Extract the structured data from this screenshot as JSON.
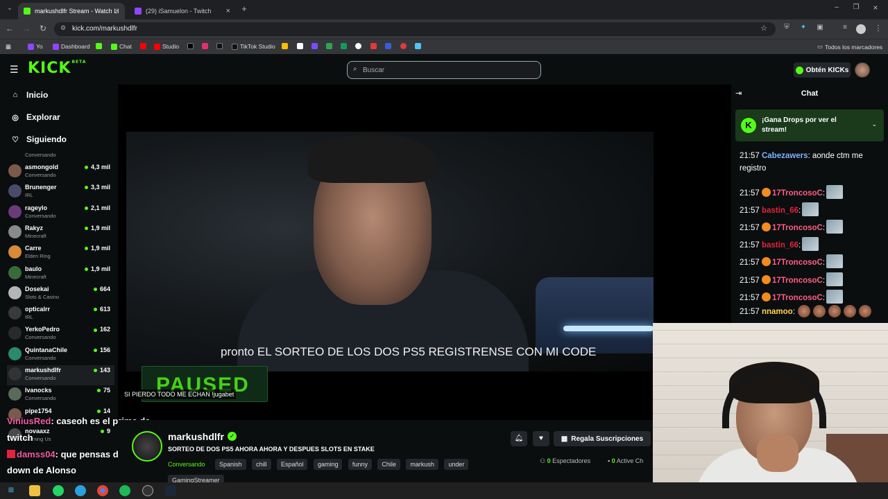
{
  "browser": {
    "tabs": [
      {
        "title": "markushdlfr Stream - Watch Li",
        "active": true,
        "color": "#53fc18"
      },
      {
        "title": "(29) iSamuelon - Twitch",
        "active": false,
        "color": "#9146ff"
      }
    ],
    "url": "kick.com/markushdlfr",
    "bookmarks": [
      "Yo",
      "Dashboard",
      "Chat",
      "Studio",
      "TikTok Studio"
    ],
    "bookmarks_folder": "Todos los marcadores"
  },
  "header": {
    "logo": "KICK",
    "logo_badge": "BETA",
    "search_placeholder": "Buscar",
    "get_kicks": "Obtén KICKs"
  },
  "sidebar": {
    "nav": [
      {
        "label": "Inicio",
        "icon": "home-icon"
      },
      {
        "label": "Explorar",
        "icon": "compass-icon"
      },
      {
        "label": "Siguiendo",
        "icon": "heart-icon"
      }
    ],
    "partial_top_category": "Conversando",
    "channels": [
      {
        "name": "asmongold",
        "category": "Conversando",
        "viewers": "4,3 mil",
        "color": "#7b5a4a"
      },
      {
        "name": "Brunenger",
        "category": "IRL",
        "viewers": "3,3 mil",
        "color": "#4a4a6a"
      },
      {
        "name": "rageylo",
        "category": "Conversando",
        "viewers": "2,1 mil",
        "color": "#6a3a7a"
      },
      {
        "name": "Rakyz",
        "category": "Minecraft",
        "viewers": "1,9 mil",
        "color": "#8a8a8a"
      },
      {
        "name": "Carre",
        "category": "Elden Ring",
        "viewers": "1,9 mil",
        "color": "#d9893a"
      },
      {
        "name": "baulo",
        "category": "Minecraft",
        "viewers": "1,9 mil",
        "color": "#3a6a3a"
      },
      {
        "name": "Dosekai",
        "category": "Slots & Casino",
        "viewers": "664",
        "color": "#b5b5b5"
      },
      {
        "name": "opticalrr",
        "category": "IRL",
        "viewers": "613",
        "color": "#3a3a3a"
      },
      {
        "name": "YerkoPedro",
        "category": "Conversando",
        "viewers": "162",
        "color": "#2a2a2a"
      },
      {
        "name": "QuintanaChile",
        "category": "Conversando",
        "viewers": "156",
        "color": "#2a8a6a"
      },
      {
        "name": "markushdlfr",
        "category": "Conversando",
        "viewers": "143",
        "color": "#333333",
        "selected": true
      },
      {
        "name": "Ivanocks",
        "category": "Conversando",
        "viewers": "75",
        "color": "#5a6a5a"
      },
      {
        "name": "pipe1754",
        "category": "",
        "viewers": "14",
        "color": "#7a5a4a"
      },
      {
        "name": "novaaxz",
        "category": "Gaming Us",
        "viewers": "9",
        "color": "#4a4a4a"
      }
    ]
  },
  "player": {
    "subtitle": "pronto EL SORTEO DE LOS DOS PS5 REGISTRENSE CON MI CODE",
    "paused_label": "PAUSED",
    "overlay_text": "SI PIERDO TODO ME ECHAN !jugabet"
  },
  "stream_overlay_chat": [
    {
      "user": "ViniusRed",
      "user_color": "#f05aa0",
      "text": ": caseoh es el prime de"
    },
    {
      "user": "",
      "user_color": "#ffffff",
      "text": "twitch"
    },
    {
      "user": "damss04",
      "user_color": "#f05aa0",
      "text": ": que pensas del"
    },
    {
      "user": "",
      "user_color": "#ffffff",
      "text": "down de Alonso"
    }
  ],
  "stream_info": {
    "streamer": "markushdlfr",
    "title": "SORTEO DE DOS PS5 AHORA AHORA Y DESPUES SLOTS EN STAKE",
    "category": "Conversando",
    "tags": [
      "Spanish",
      "chill",
      "Español",
      "gaming",
      "funny",
      "Chile",
      "markush",
      "under",
      "GamingStreamer"
    ],
    "subs_button": "Regala Suscripciones",
    "viewers_count": "0",
    "viewers_label": "Espectadores",
    "active_count": "0",
    "active_label": "Active Ch"
  },
  "chat": {
    "title": "Chat",
    "drops_banner": "¡Gana Drops por ver el stream!",
    "messages": [
      {
        "time": "21:57",
        "user": "Cabezawers",
        "user_color": "#7fb3ff",
        "badge": false,
        "text": ": aonde ctm me registro",
        "emotes": 0
      },
      {
        "time": "21:57",
        "user": "17TroncosoC",
        "user_color": "#ff5e85",
        "badge": true,
        "text": ":",
        "emotes": 1
      },
      {
        "time": "21:57",
        "user": "bastin_66",
        "user_color": "#e0243c",
        "badge": false,
        "text": ":",
        "emotes": 1
      },
      {
        "time": "21:57",
        "user": "17TroncosoC",
        "user_color": "#ff5e85",
        "badge": true,
        "text": ":",
        "emotes": 1
      },
      {
        "time": "21:57",
        "user": "bastin_66",
        "user_color": "#e0243c",
        "badge": false,
        "text": ":",
        "emotes": 1
      },
      {
        "time": "21:57",
        "user": "17TroncosoC",
        "user_color": "#ff5e85",
        "badge": true,
        "text": ":",
        "emotes": 1
      },
      {
        "time": "21:57",
        "user": "17TroncosoC",
        "user_color": "#ff5e85",
        "badge": true,
        "text": ":",
        "emotes": 1
      },
      {
        "time": "21:57",
        "user": "17TroncosoC",
        "user_color": "#ff5e85",
        "badge": true,
        "text": ":",
        "emotes": 1
      },
      {
        "time": "21:57",
        "user": "nnamoo",
        "user_color": "#ffd34e",
        "badge": false,
        "text": ":",
        "emotes": 5
      }
    ]
  },
  "colors": {
    "accent": "#53fc18",
    "bg": "#0b0e0f",
    "panel": "#24272c"
  }
}
